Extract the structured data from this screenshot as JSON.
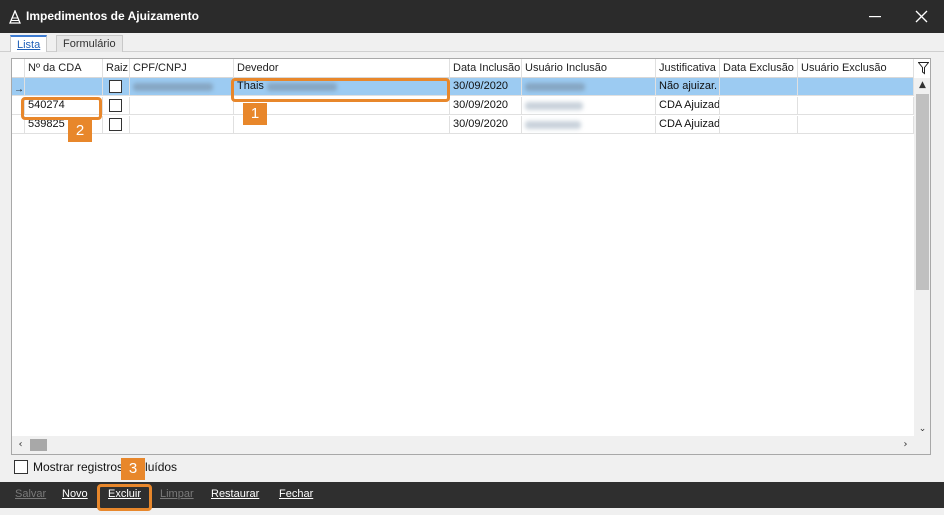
{
  "window": {
    "title": "Impedimentos de Ajuizamento",
    "minimize_glyph": "—",
    "close_glyph": "✕"
  },
  "tabs": [
    {
      "label": "Lista",
      "active": true
    },
    {
      "label": "Formulário",
      "active": false
    }
  ],
  "grid": {
    "columns": [
      "Nº da CDA",
      "Raiz",
      "CPF/CNPJ",
      "Devedor",
      "Data Inclusão",
      "Usuário Inclusão",
      "Justificativa",
      "Data Exclusão",
      "Usuário Exclusão"
    ],
    "rows": [
      {
        "indicator": "→",
        "cda": "",
        "raiz": false,
        "cpf_cnpj": "[redacted]",
        "devedor": "Thais",
        "data_inclusao": "30/09/2020",
        "usuario_inclusao": "[redacted]",
        "justificativa": "Não ajuizar.",
        "data_exclusao": "",
        "usuario_exclusao": "",
        "selected": true
      },
      {
        "indicator": "",
        "cda": "540274",
        "raiz": false,
        "cpf_cnpj": "",
        "devedor": "",
        "data_inclusao": "30/09/2020",
        "usuario_inclusao": "[redacted]",
        "justificativa": "CDA Ajuizad",
        "data_exclusao": "",
        "usuario_exclusao": "",
        "selected": false
      },
      {
        "indicator": "",
        "cda": "539825",
        "raiz": false,
        "cpf_cnpj": "",
        "devedor": "",
        "data_inclusao": "30/09/2020",
        "usuario_inclusao": "[redacted]",
        "justificativa": "CDA Ajuizad",
        "data_exclusao": "",
        "usuario_exclusao": "",
        "selected": false
      }
    ]
  },
  "show_deleted": {
    "label": "Mostrar registros excluídos",
    "checked": false
  },
  "toolbar": {
    "salvar": "Salvar",
    "novo": "Novo",
    "excluir": "Excluir",
    "limpar": "Limpar",
    "restaurar": "Restaurar",
    "fechar": "Fechar"
  },
  "annotations": [
    "1",
    "2",
    "3"
  ],
  "colors": {
    "titlebar": "#2b2b2b",
    "selected_row": "#9ccbf2",
    "highlight": "#e8872b",
    "toolbar": "#2f2f2f"
  }
}
